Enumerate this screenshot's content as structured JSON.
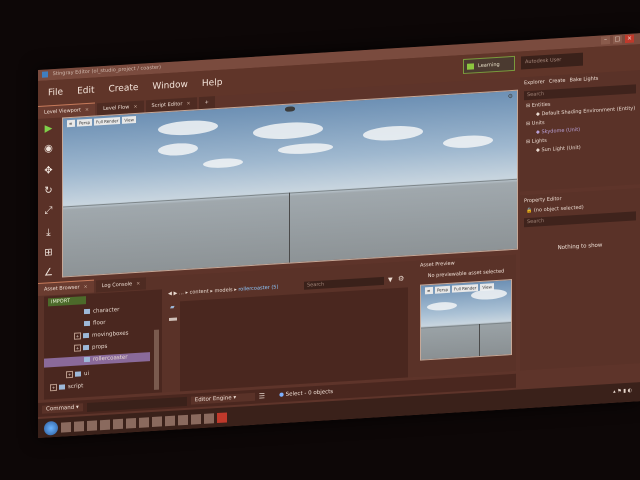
{
  "window": {
    "title": "Stingray Editor (ol_studio_project / coaster)"
  },
  "menu": [
    "File",
    "Edit",
    "Create",
    "Window",
    "Help"
  ],
  "header": {
    "learning_label": "Learning",
    "signin_placeholder": "Autodesk User"
  },
  "tabs": [
    {
      "label": "Level Viewport"
    },
    {
      "label": "Level Flow"
    },
    {
      "label": "Script Editor"
    }
  ],
  "viewport": {
    "buttons": [
      "Persp",
      "Full Render",
      "View"
    ]
  },
  "explorer": {
    "tabs": [
      "Explorer",
      "Create",
      "Bake Lights"
    ],
    "search_placeholder": "Search",
    "items": [
      {
        "label": "Entities"
      },
      {
        "label": "Default Shading Environment (Entity)"
      },
      {
        "label": "Units"
      },
      {
        "label": "Skydome (Unit)"
      },
      {
        "label": "Lights"
      },
      {
        "label": "Sun Light (Unit)"
      }
    ]
  },
  "property_editor": {
    "title": "Property Editor",
    "selection": "(no object selected)",
    "search_placeholder": "Search",
    "empty_text": "Nothing to show"
  },
  "bottom_tabs": [
    "Asset Browser",
    "Log Console"
  ],
  "asset_browser": {
    "import_label": "IMPORT",
    "tree": [
      "character",
      "floor",
      "movingboxes",
      "props",
      "rollercoaster",
      "ui",
      "script"
    ],
    "path": [
      "content",
      "models"
    ],
    "path_current": "rollercoaster (5)",
    "search_placeholder": "Search"
  },
  "asset_preview": {
    "title": "Asset Preview",
    "message": "No previewable asset selected",
    "buttons": [
      "Persp",
      "Full Render",
      "View"
    ]
  },
  "statusbar": {
    "command_label": "Command",
    "engine_label": "Editor Engine",
    "selection_text": "Select - 0 objects"
  }
}
